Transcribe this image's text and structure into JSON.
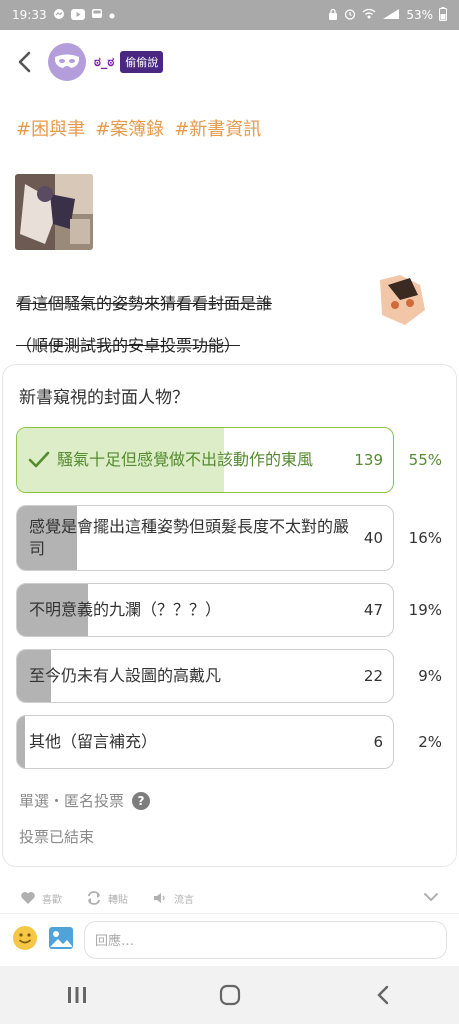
{
  "status_bar": {
    "time": "19:33",
    "battery": "53%",
    "left_icons": [
      "messenger-icon",
      "youtube-icon",
      "bus-icon",
      "dot-icon"
    ],
    "right_icons": [
      "lock-icon",
      "alarm-icon",
      "hotspot-icon",
      "signal-icon",
      "battery-icon"
    ]
  },
  "header": {
    "username": "ಠ_ಠ",
    "badge": "偷偷說"
  },
  "tags": [
    "#困與聿",
    "#案簿錄",
    "#新書資訊"
  ],
  "post": {
    "line1": "看這個騷氣的姿勢來猜看看封面是誰",
    "line2": "（順便測試我的安卓投票功能）"
  },
  "poll": {
    "question": "新書窺視的封面人物？",
    "options": [
      {
        "label": "騷氣十足但感覺做不出該動作的東風",
        "count": "139",
        "percent": "55%",
        "fraction": 0.55,
        "selected": true
      },
      {
        "label": "感覺是會擺出這種姿勢但頭髮長度不太對的嚴司",
        "count": "40",
        "percent": "16%",
        "fraction": 0.16,
        "selected": false
      },
      {
        "label": "不明意義的九瀾（？？？）",
        "count": "47",
        "percent": "19%",
        "fraction": 0.19,
        "selected": false
      },
      {
        "label": "至今仍未有人設圖的高戴凡",
        "count": "22",
        "percent": "9%",
        "fraction": 0.09,
        "selected": false
      },
      {
        "label": "其他（留言補充）",
        "count": "6",
        "percent": "2%",
        "fraction": 0.02,
        "selected": false
      }
    ],
    "meta": "單選・匿名投票",
    "help": "?",
    "status": "投票已結束"
  },
  "actions": {
    "like": "喜歡",
    "repost": "轉貼",
    "comment": "流言"
  },
  "reply": {
    "placeholder": "回應…"
  },
  "colors": {
    "tag": "#e69a4c",
    "winner_fill": "#dcedc8",
    "winner_border": "#8bc34a",
    "winner_text": "#558b2f",
    "bar_fill": "#b3b3b3",
    "badge": "#4a2882",
    "avatar": "#b39ddb"
  }
}
